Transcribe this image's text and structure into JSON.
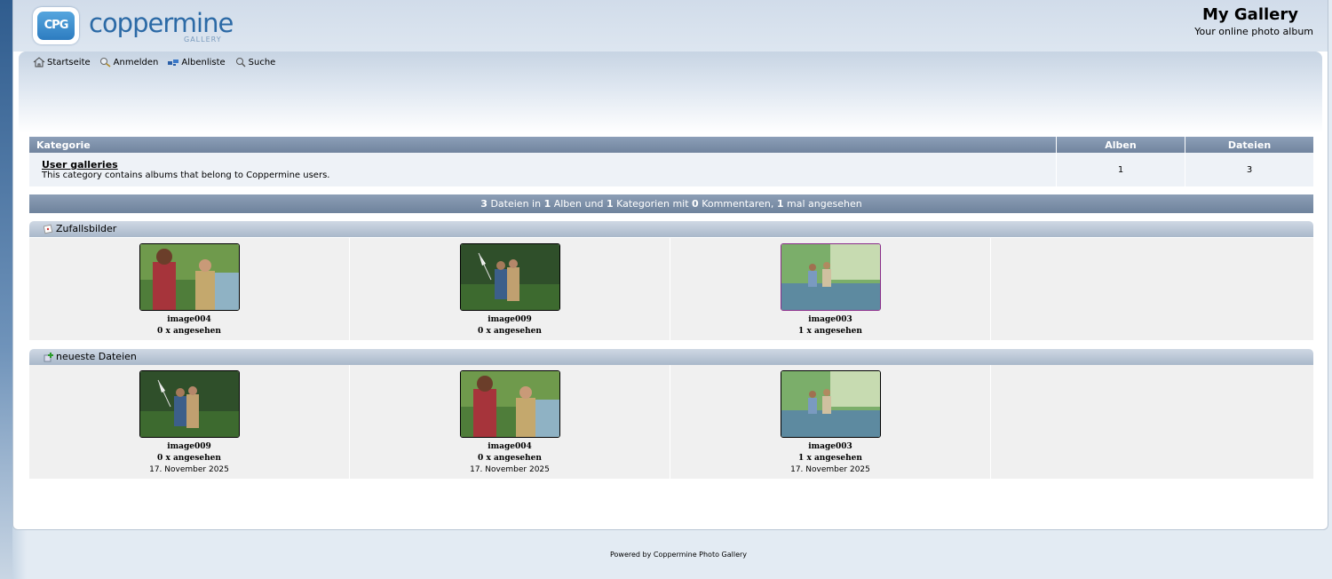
{
  "header": {
    "logo_badge": "CPG",
    "logo_text": "coppermine",
    "logo_sub": "GALLERY",
    "site_title": "My Gallery",
    "site_description": "Your online photo album"
  },
  "nav": {
    "items": [
      {
        "label": "Startseite",
        "icon": "home-icon"
      },
      {
        "label": "Anmelden",
        "icon": "login-icon"
      },
      {
        "label": "Albenliste",
        "icon": "album-list-icon"
      },
      {
        "label": "Suche",
        "icon": "search-icon"
      }
    ]
  },
  "categories": {
    "headers": {
      "category": "Kategorie",
      "albums": "Alben",
      "files": "Dateien"
    },
    "rows": [
      {
        "name": "User galleries",
        "description": "This category contains albums that belong to Coppermine users.",
        "albums": "1",
        "files": "3"
      }
    ]
  },
  "stats": {
    "files": "3",
    "t1": " Dateien in ",
    "albums": "1",
    "t2": " Alben und ",
    "categories": "1",
    "t3": " Kategorien mit ",
    "comments": "0",
    "t4": " Kommentaren, ",
    "views": "1",
    "t5": " mal angesehen"
  },
  "random": {
    "title": "Zufallsbilder",
    "icon": "random-icon",
    "items": [
      {
        "name": "image004",
        "views": "0 x angesehen"
      },
      {
        "name": "image009",
        "views": "0 x angesehen"
      },
      {
        "name": "image003",
        "views": "1 x angesehen"
      }
    ]
  },
  "latest": {
    "title": "neueste Dateien",
    "icon": "new-files-icon",
    "items": [
      {
        "name": "image009",
        "views": "0 x angesehen",
        "date": "17. November 2025"
      },
      {
        "name": "image004",
        "views": "0 x angesehen",
        "date": "17. November 2025"
      },
      {
        "name": "image003",
        "views": "1 x angesehen",
        "date": "17. November 2025"
      }
    ]
  },
  "footer": {
    "text": "Powered by Coppermine Photo Gallery"
  },
  "colors": {
    "header_bar": "#7d90aa",
    "accent_blue": "#2c6aa6",
    "selected_border": "#8a2c8a"
  }
}
